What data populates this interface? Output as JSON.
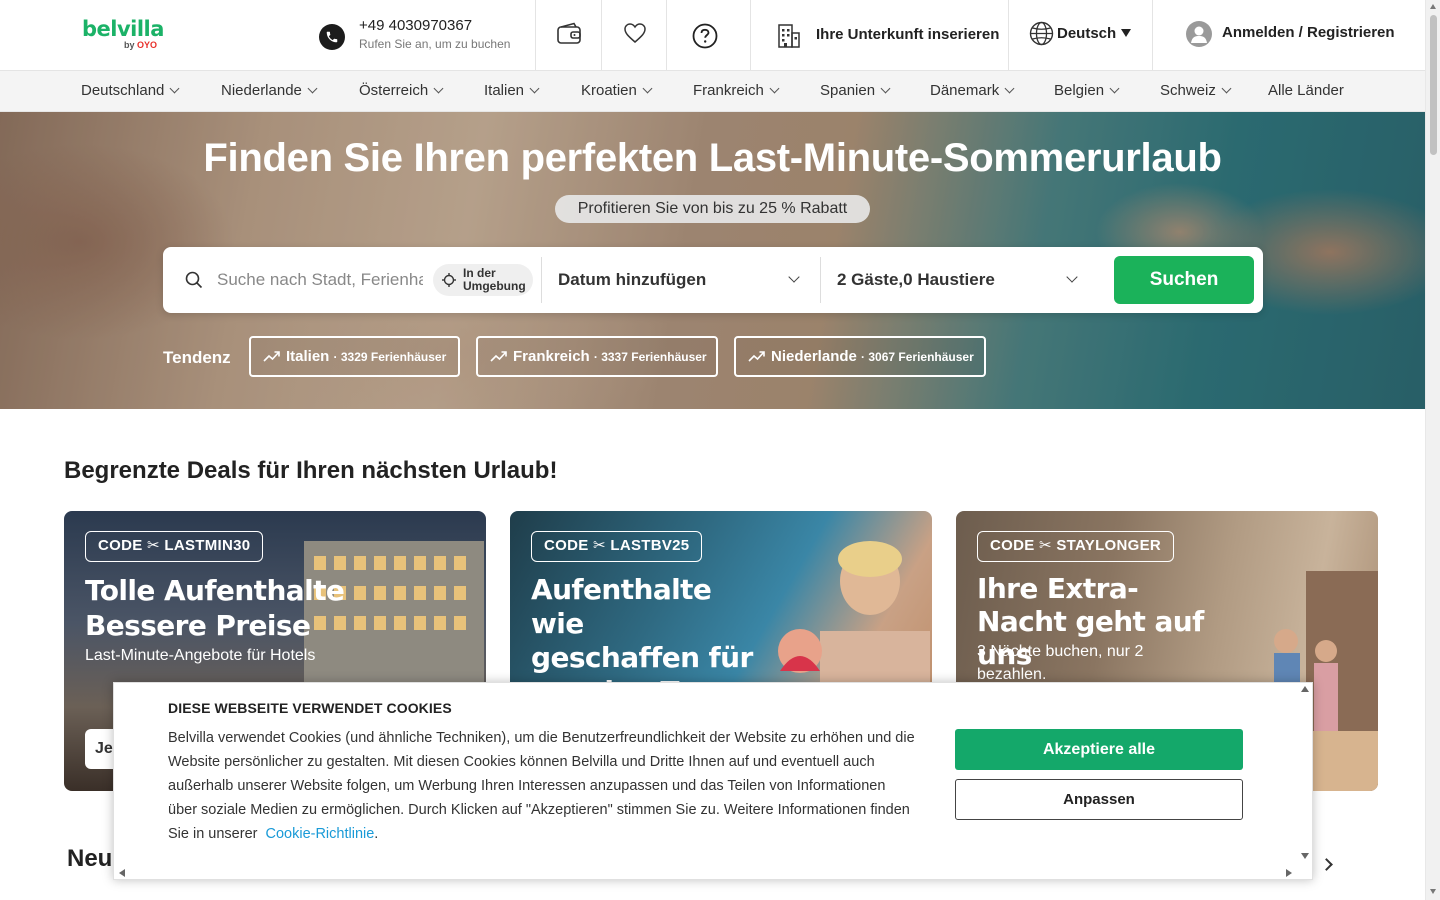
{
  "header": {
    "logo_text": "belvilla",
    "logo_by": "by",
    "logo_oyo": "OYO",
    "phone_number": "+49 4030970367",
    "phone_subtitle": "Rufen Sie an, um zu buchen",
    "host_label": "Ihre Unterkunft inserieren",
    "language_label": "Deutsch",
    "login_label": "Anmelden / Registrieren"
  },
  "nav": {
    "countries": [
      "Deutschland",
      "Niederlande",
      "Österreich",
      "Italien",
      "Kroatien",
      "Frankreich",
      "Spanien",
      "Dänemark",
      "Belgien",
      "Schweiz"
    ],
    "all_countries": "Alle Länder"
  },
  "hero": {
    "title": "Finden Sie Ihren perfekten Last-Minute-Sommerurlaub",
    "discount_pill": "Profitieren Sie von bis zu 25 % Rabatt",
    "search_placeholder": "Suche nach Stadt, Ferienhaus",
    "nearby_label": "In der Umgebung",
    "date_label": "Datum hinzufügen",
    "guests_label": "2 Gäste,0 Haustiere",
    "search_button": "Suchen",
    "trend_label": "Tendenz",
    "trends": [
      {
        "name": "Italien",
        "count": "· 3329 Ferienhäuser"
      },
      {
        "name": "Frankreich",
        "count": "· 3337 Ferienhäuser"
      },
      {
        "name": "Niederlande",
        "count": "· 3067 Ferienhäuser"
      }
    ]
  },
  "deals": {
    "title": "Begrenzte Deals für Ihren nächsten Urlaub!",
    "cards": [
      {
        "code_prefix": "CODE",
        "code": "LASTMIN30",
        "title": "Tolle Aufenthalte Bessere Preise",
        "subtitle": "Last-Minute-Angebote für Hotels",
        "cta": "Je"
      },
      {
        "code_prefix": "CODE",
        "code": "LASTBV25",
        "title": "Aufenthalte wie geschaffen für sonnige Tage",
        "subtitle": "",
        "cta": ""
      },
      {
        "code_prefix": "CODE",
        "code": "STAYLONGER",
        "title": "Ihre Extra-Nacht geht auf uns",
        "subtitle": "3 Nächte buchen, nur 2 bezahlen.",
        "cta": ""
      }
    ]
  },
  "section2_title": "Neu",
  "cookie": {
    "heading": "DIESE WEBSEITE VERWENDET COOKIES",
    "body": "Belvilla verwendet Cookies (und ähnliche Techniken), um die Benutzerfreundlichkeit der Website zu erhöhen und die Website persönlicher zu gestalten. Mit diesen Cookies können Belvilla und Dritte Ihnen auf und eventuell auch außerhalb unserer Website folgen, um Werbung Ihren Interessen anzupassen und das Teilen von Informationen über soziale Medien zu ermöglichen. Durch Klicken auf \"Akzeptieren\" stimmen Sie zu. Weitere Informationen finden Sie in unserer",
    "link": "Cookie-Richtlinie",
    "link_suffix": ".",
    "accept_button": "Akzeptiere alle",
    "adjust_button": "Anpassen"
  },
  "colors": {
    "brand_green": "#1bb267",
    "search_button": "#1bb25a",
    "accept_button": "#14a86a",
    "link": "#199ad7"
  }
}
